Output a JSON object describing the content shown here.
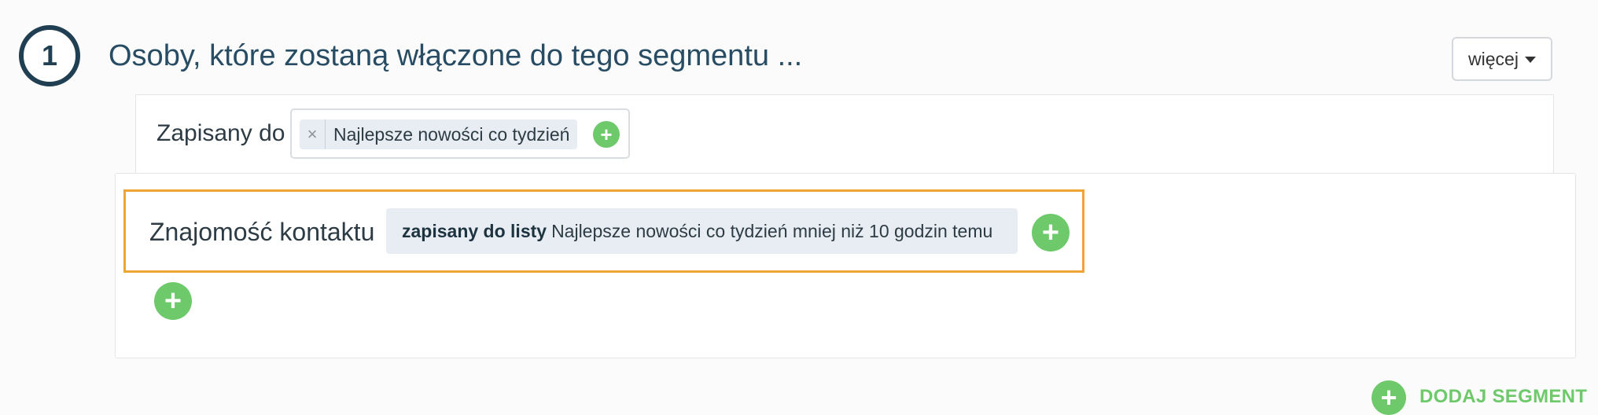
{
  "step": {
    "number": "1",
    "title": "Osoby, które zostaną włączone do tego segmentu ..."
  },
  "more_menu": {
    "label": "więcej"
  },
  "condition_saved": {
    "label": "Zapisany do",
    "tag": "Najlepsze nowości co tydzień",
    "remove_icon": "×",
    "add_icon": "+"
  },
  "condition_contact": {
    "label": "Znajomość kontaktu",
    "chip_bold": "zapisany do listy",
    "chip_text": "Najlepsze nowości co tydzień mniej niż 10 godzin temu",
    "add_icon": "+"
  },
  "add_row": {
    "icon": "+"
  },
  "add_segment": {
    "icon": "+",
    "label": "DODAJ SEGMENT"
  },
  "colors": {
    "accent_green": "#6dc96a",
    "highlight_orange": "#f0a336",
    "title_blue": "#274c63"
  }
}
